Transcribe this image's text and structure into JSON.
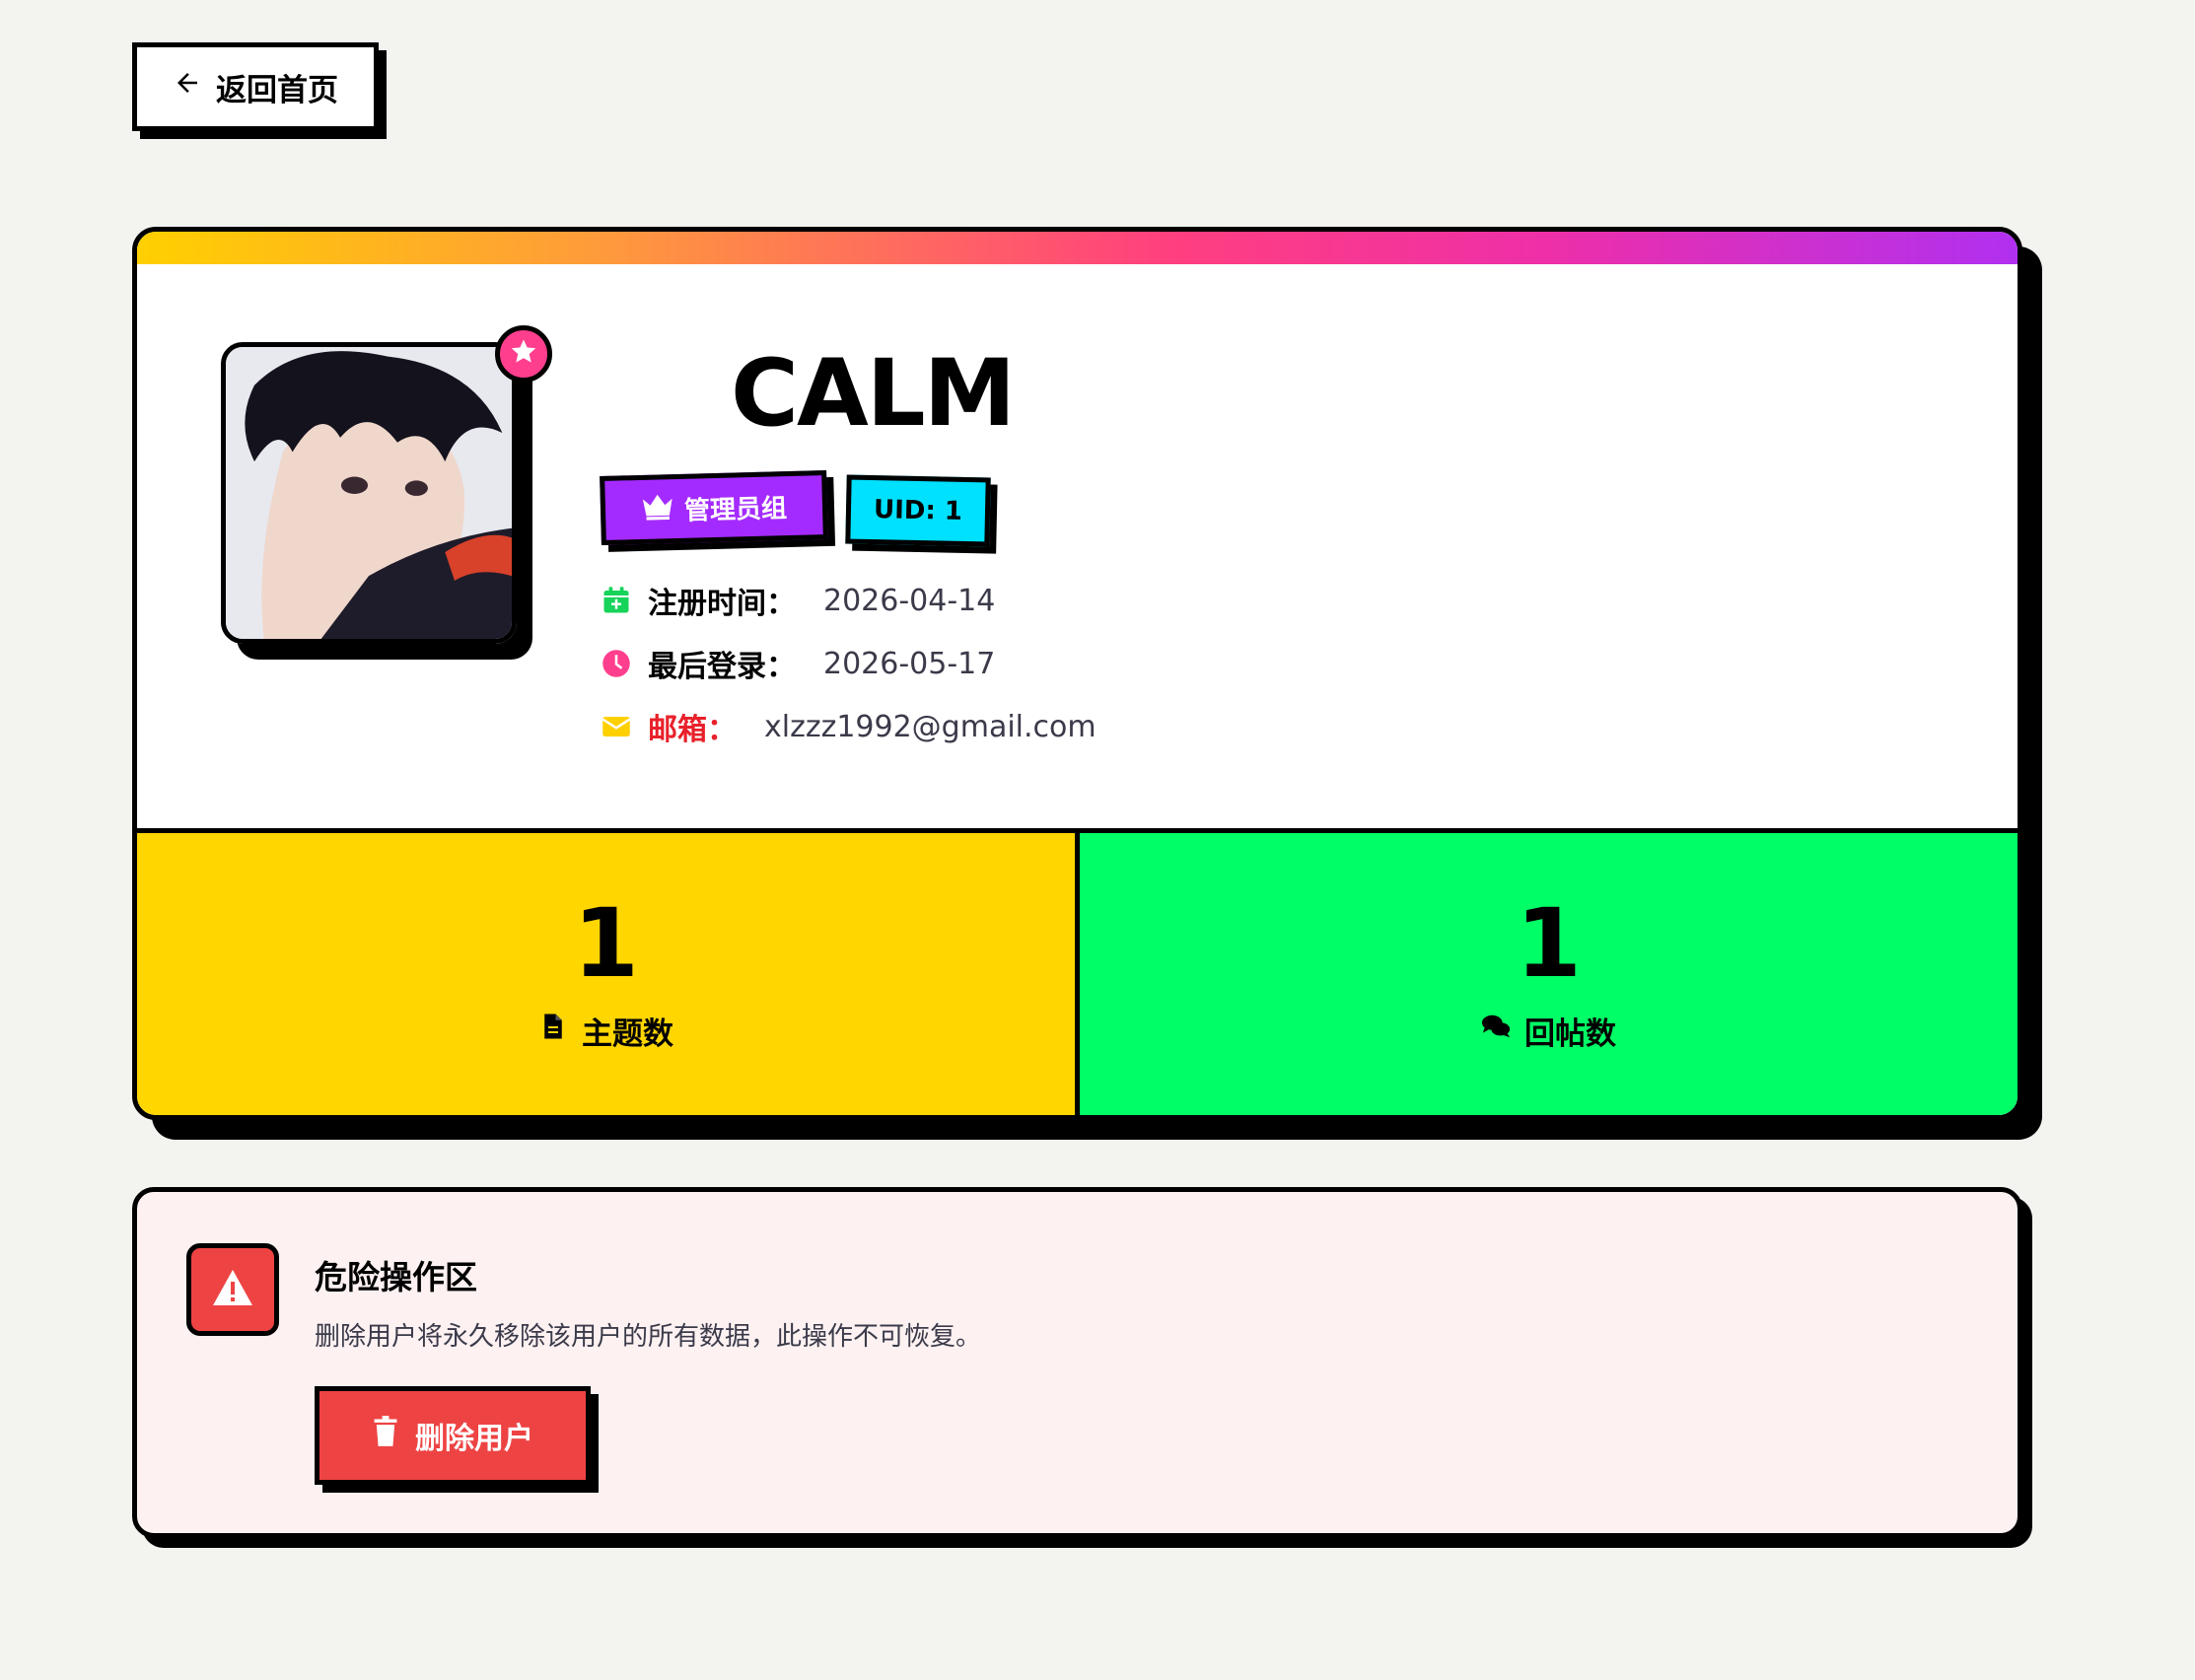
{
  "nav": {
    "back_label": "返回首页"
  },
  "profile": {
    "username": "CALM",
    "group_tag": "管理员组",
    "uid_tag": "UID: 1",
    "register_label": "注册时间：",
    "register_value": "2026-04-14",
    "last_login_label": "最后登录：",
    "last_login_value": "2026-05-17",
    "email_label": "邮箱：",
    "email_value": "xlzzz1992@gmail.com"
  },
  "stats": {
    "topics": {
      "value": "1",
      "label": "主题数"
    },
    "replies": {
      "value": "1",
      "label": "回帖数"
    }
  },
  "danger": {
    "title": "危险操作区",
    "description": "删除用户将永久移除该用户的所有数据，此操作不可恢复。",
    "delete_label": "删除用户"
  },
  "colors": {
    "background": "#f3f3ef",
    "group_tag": "#a42bff",
    "uid_tag": "#00e0ff",
    "topics_panel": "#ffd600",
    "replies_panel": "#00ff66",
    "danger": "#ee4343",
    "email_label": "#e8202a"
  },
  "icons": {
    "back": "arrow-left-icon",
    "avatar_badge": "star-icon",
    "group": "crown-icon",
    "register": "calendar-plus-icon",
    "last_login": "clock-icon",
    "email": "envelope-icon",
    "topics": "file-icon",
    "replies": "comments-icon",
    "danger": "warning-triangle-icon",
    "delete": "trash-icon"
  }
}
